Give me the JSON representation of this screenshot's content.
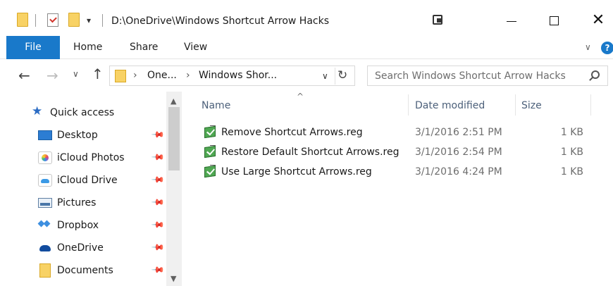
{
  "window": {
    "title": "D:\\OneDrive\\Windows Shortcut Arrow Hacks",
    "qa_dropdown": "▾",
    "close_glyph": "✕"
  },
  "ribbon": {
    "tabs": [
      {
        "label": "File",
        "active": true
      },
      {
        "label": "Home"
      },
      {
        "label": "Share"
      },
      {
        "label": "View"
      }
    ],
    "expand_glyph": "∨",
    "help_glyph": "?"
  },
  "navigation": {
    "back_glyph": "←",
    "forward_glyph": "→",
    "recent_glyph": "∨",
    "up_glyph": "↑",
    "address_segments": [
      "One...",
      "Windows Shor..."
    ],
    "address_dropdown": "∨",
    "refresh_glyph": "↻",
    "search_placeholder": "Search Windows Shortcut Arrow Hacks"
  },
  "sidebar": {
    "quick_access": {
      "label": "Quick access",
      "icon": "star-icon"
    },
    "items": [
      {
        "label": "Desktop",
        "icon": "desktop-icon",
        "pinned": true
      },
      {
        "label": "iCloud Photos",
        "icon": "icloud-photos-icon",
        "pinned": true
      },
      {
        "label": "iCloud Drive",
        "icon": "icloud-drive-icon",
        "pinned": true
      },
      {
        "label": "Pictures",
        "icon": "pictures-icon",
        "pinned": true
      },
      {
        "label": "Dropbox",
        "icon": "dropbox-icon",
        "pinned": true
      },
      {
        "label": "OneDrive",
        "icon": "onedrive-icon",
        "pinned": true
      },
      {
        "label": "Documents",
        "icon": "folder-icon",
        "pinned": true
      }
    ],
    "pin_glyph": "📌",
    "scroll_up_glyph": "▲",
    "scroll_down_glyph": "▼"
  },
  "file_list": {
    "sort_glyph": "^",
    "columns": [
      "Name",
      "Date modified",
      "Size"
    ],
    "files": [
      {
        "name": "Remove Shortcut Arrows.reg",
        "date": "3/1/2016 2:51 PM",
        "size": "1 KB",
        "icon": "registry-file-icon"
      },
      {
        "name": "Restore Default Shortcut Arrows.reg",
        "date": "3/1/2016 2:54 PM",
        "size": "1 KB",
        "icon": "registry-file-icon"
      },
      {
        "name": "Use Large Shortcut Arrows.reg",
        "date": "3/1/2016 4:24 PM",
        "size": "1 KB",
        "icon": "registry-file-icon"
      }
    ]
  },
  "colors": {
    "accent": "#1979ca",
    "folder": "#f8d265",
    "header_text": "#4c607a"
  }
}
